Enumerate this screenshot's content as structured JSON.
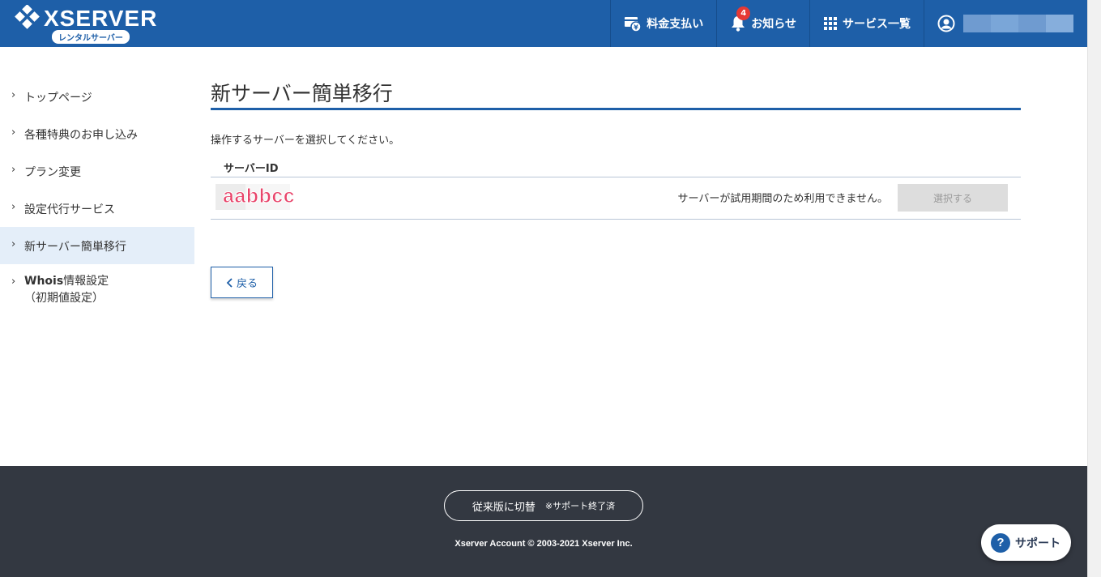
{
  "header": {
    "logo_text": "XSERVER",
    "logo_sub": "レンタルサーバー",
    "nav": [
      {
        "label": "料金支払い",
        "icon": "payment-icon"
      },
      {
        "label": "お知らせ",
        "icon": "bell-icon",
        "badge": "4"
      },
      {
        "label": "サービス一覧",
        "icon": "grid-icon"
      }
    ],
    "user_icon": "user-circle-icon"
  },
  "sidebar": {
    "items": [
      {
        "label": "トップページ"
      },
      {
        "label": "各種特典のお申し込み"
      },
      {
        "label": "プラン変更"
      },
      {
        "label": "設定代行サービス"
      },
      {
        "label": "新サーバー簡単移行",
        "active": true
      },
      {
        "label_bold": "Whois",
        "label": "情報設定",
        "label_line2": "（初期値設定）"
      }
    ]
  },
  "main": {
    "title": "新サーバー簡単移行",
    "instruction": "操作するサーバーを選択してください。",
    "column_header": "サーバーID",
    "row": {
      "server_id": "aabbcc",
      "message": "サーバーが試用期間のため利用できません。",
      "button": "選択する"
    },
    "back_button": "戻る"
  },
  "footer": {
    "switch_label": "従来版に切替",
    "switch_note": "※サポート終了済",
    "copyright": "Xserver Account © 2003-2021 Xserver Inc."
  },
  "support": {
    "label": "サポート",
    "icon": "question-icon"
  },
  "colors": {
    "brand": "#1e5fa8",
    "footer": "#333841",
    "active_bg": "#e4eef9",
    "badge": "#e53935"
  }
}
